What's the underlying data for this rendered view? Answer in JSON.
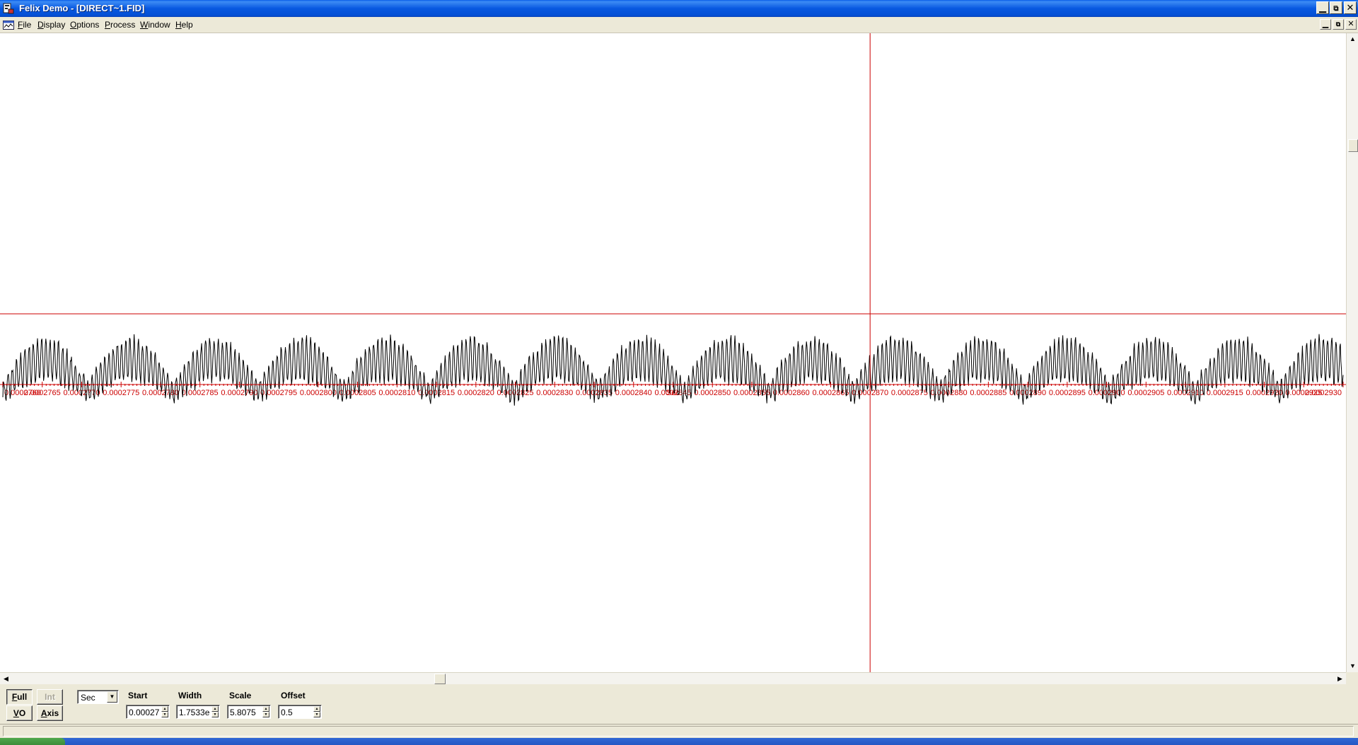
{
  "window": {
    "title": "Felix Demo - [DIRECT~1.FID]"
  },
  "menu": {
    "items": [
      {
        "label": "File",
        "accel": "F",
        "rest": "ile"
      },
      {
        "label": "Display",
        "accel": "D",
        "rest": "isplay"
      },
      {
        "label": "Options",
        "accel": "O",
        "rest": "ptions"
      },
      {
        "label": "Process",
        "accel": "P",
        "rest": "rocess"
      },
      {
        "label": "Window",
        "accel": "W",
        "rest": "indow"
      },
      {
        "label": "Help",
        "accel": "H",
        "rest": "elp"
      }
    ]
  },
  "icons": {
    "app": "felix-app-icon",
    "document": "document-icon",
    "minimize": "minimize-icon",
    "restore": "restore-icon",
    "close": "close-icon",
    "scroll_up": "arrow-up-icon",
    "scroll_down": "arrow-down-icon",
    "scroll_left": "arrow-left-icon",
    "scroll_right": "arrow-right-icon",
    "dropdown": "chevron-down-icon"
  },
  "colors": {
    "axis": "#cc0000",
    "cursor": "#cc0000",
    "trace": "#000000",
    "titlebar": "#0a5ee8"
  },
  "chart_data": {
    "type": "line",
    "xlabel": "Sec",
    "x_range": [
      0.000276,
      0.000293
    ],
    "tick_labels": [
      "0.0002760",
      "0.0002765",
      "0.0002770",
      "0.0002775",
      "0.0002780",
      "0.0002785",
      "0.0002790",
      "0.0002795",
      "0.0002800",
      "0.0002805",
      "0.0002810",
      "0.0002815",
      "0.0002820",
      "0.0002825",
      "0.0002830",
      "0.0002835",
      "0.0002840",
      "0.0002845",
      "0.0002850",
      "0.0002855",
      "0.0002860",
      "0.0002865",
      "0.0002870",
      "0.0002875",
      "0.0002880",
      "0.0002885",
      "0.0002890",
      "0.0002895",
      "0.0002900",
      "0.0002905",
      "0.0002910",
      "0.0002915",
      "0.0002920",
      "0.0002925",
      "0.0002930"
    ],
    "signal": {
      "description_free": true,
      "carrier_period": 1.08e-06,
      "fine_period": 5.33e-08,
      "baseline": 0,
      "arch_amplitude": 0.48,
      "fine_amplitude": 0.22
    },
    "cursor_x": 0.000287,
    "reference_line_y": 1.0
  },
  "controls": {
    "full_label": "Full",
    "full_accel": "F",
    "full_rest": "ull",
    "int_label": "Int",
    "vo_label": "VO",
    "vo_accel": "V",
    "vo_rest": "O",
    "axis_label": "Axis",
    "axis_accel": "A",
    "axis_rest": "xis",
    "units_value": "Sec",
    "start_label": "Start",
    "start_value": "0.00027",
    "width_label": "Width",
    "width_value": "1.7533e",
    "scale_label": "Scale",
    "scale_value": "5.8075",
    "offset_label": "Offset",
    "offset_value": "0.5"
  },
  "status": {
    "text": ""
  }
}
